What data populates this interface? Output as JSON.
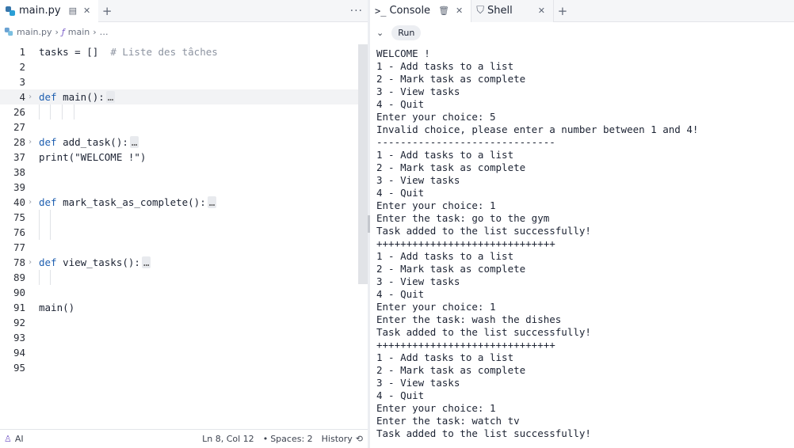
{
  "editor_tab": {
    "filename": "main.py"
  },
  "breadcrumb": {
    "file": "main.py",
    "symbol": "main",
    "more": "…"
  },
  "code_lines": [
    {
      "num": "1",
      "html_parts": [
        {
          "t": "tasks = []  ",
          "c": ""
        },
        {
          "t": "# Liste des tâches",
          "c": "cm"
        }
      ],
      "fold": false
    },
    {
      "num": "2",
      "html_parts": [],
      "fold": false
    },
    {
      "num": "3",
      "html_parts": [],
      "fold": false
    },
    {
      "num": "4",
      "html_parts": [
        {
          "t": "def",
          "c": "kw"
        },
        {
          "t": " main():",
          "c": ""
        }
      ],
      "fold": true,
      "ellipsis": true,
      "active": true
    },
    {
      "num": "26",
      "html_parts": [],
      "fold": false,
      "guides": true
    },
    {
      "num": "27",
      "html_parts": [],
      "fold": false
    },
    {
      "num": "28",
      "html_parts": [
        {
          "t": "def",
          "c": "kw"
        },
        {
          "t": " add_task():",
          "c": ""
        }
      ],
      "fold": true,
      "ellipsis": true
    },
    {
      "num": "37",
      "html_parts": [
        {
          "t": "print(\"WELCOME !\")",
          "c": ""
        }
      ],
      "fold": false
    },
    {
      "num": "38",
      "html_parts": [],
      "fold": false
    },
    {
      "num": "39",
      "html_parts": [],
      "fold": false
    },
    {
      "num": "40",
      "html_parts": [
        {
          "t": "def",
          "c": "kw"
        },
        {
          "t": " mark_task_as_complete():",
          "c": ""
        }
      ],
      "fold": true,
      "ellipsis": true
    },
    {
      "num": "75",
      "html_parts": [],
      "fold": false,
      "guides2": true
    },
    {
      "num": "76",
      "html_parts": [],
      "fold": false,
      "guides2": true
    },
    {
      "num": "77",
      "html_parts": [],
      "fold": false
    },
    {
      "num": "78",
      "html_parts": [
        {
          "t": "def",
          "c": "kw"
        },
        {
          "t": " view_tasks():",
          "c": ""
        }
      ],
      "fold": true,
      "ellipsis": true
    },
    {
      "num": "89",
      "html_parts": [],
      "fold": false,
      "guides2": true
    },
    {
      "num": "90",
      "html_parts": [],
      "fold": false
    },
    {
      "num": "91",
      "html_parts": [
        {
          "t": "main()",
          "c": ""
        }
      ],
      "fold": false
    },
    {
      "num": "92",
      "html_parts": [],
      "fold": false
    },
    {
      "num": "93",
      "html_parts": [],
      "fold": false
    },
    {
      "num": "94",
      "html_parts": [],
      "fold": false
    },
    {
      "num": "95",
      "html_parts": [],
      "fold": false
    }
  ],
  "ellipsis_text": "…",
  "statusbar": {
    "ai": "AI",
    "position": "Ln 8, Col 12",
    "spaces": "Spaces: 2",
    "history": "History"
  },
  "right_tabs": {
    "console": "Console",
    "shell": "Shell"
  },
  "run_label": "Run",
  "console_lines": [
    "WELCOME !",
    "1 - Add tasks to a list",
    "2 - Mark task as complete",
    "3 - View tasks",
    "4 - Quit",
    "Enter your choice: 5",
    "Invalid choice, please enter a number between 1 and 4!",
    "------------------------------",
    "1 - Add tasks to a list",
    "2 - Mark task as complete",
    "3 - View tasks",
    "4 - Quit",
    "Enter your choice: 1",
    "Enter the task: go to the gym",
    "Task added to the list successfully!",
    "++++++++++++++++++++++++++++++",
    "1 - Add tasks to a list",
    "2 - Mark task as complete",
    "3 - View tasks",
    "4 - Quit",
    "Enter your choice: 1",
    "Enter the task: wash the dishes",
    "Task added to the list successfully!",
    "++++++++++++++++++++++++++++++",
    "1 - Add tasks to a list",
    "2 - Mark task as complete",
    "3 - View tasks",
    "4 - Quit",
    "Enter your choice: 1",
    "Enter the task: watch tv",
    "Task added to the list successfully!"
  ]
}
